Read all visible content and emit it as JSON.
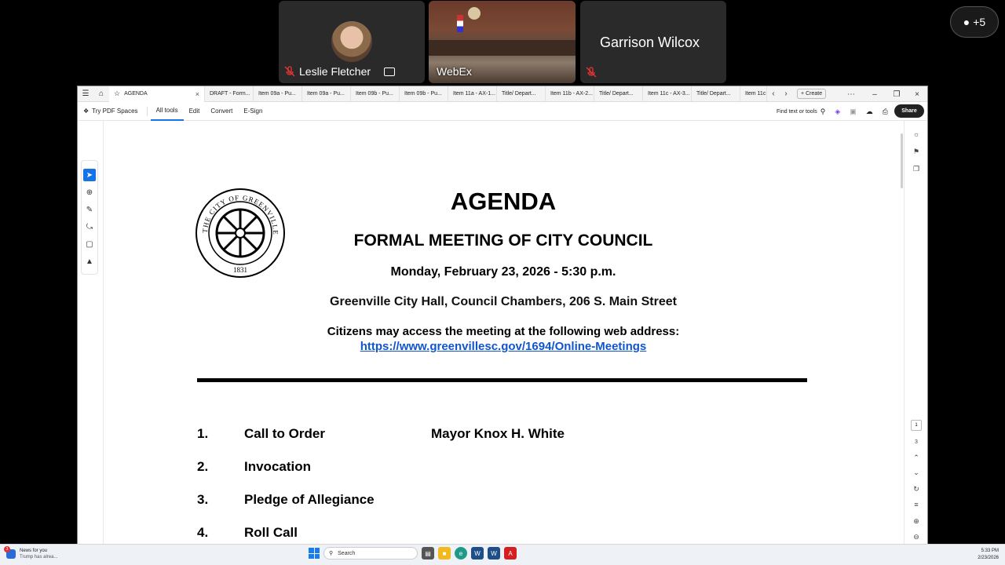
{
  "meeting": {
    "participants": [
      {
        "name": "Leslie Fletcher"
      },
      {
        "name": "WebEx"
      },
      {
        "name": "Garrison Wilcox"
      }
    ],
    "more_count": "+5"
  },
  "acrobat": {
    "tabs": [
      {
        "label": "AGENDA",
        "active": true
      },
      {
        "label": "DRAFT - Form..."
      },
      {
        "label": "Item 09a - Pu..."
      },
      {
        "label": "Item 09a - Pu..."
      },
      {
        "label": "Item 09b - Pu..."
      },
      {
        "label": "Item 09b - Pu..."
      },
      {
        "label": "Item 11a - AX-1..."
      },
      {
        "label": "Title/ Depart..."
      },
      {
        "label": "Item 11b - AX-2..."
      },
      {
        "label": "Title/ Depart..."
      },
      {
        "label": "Item 11c - AX-3..."
      },
      {
        "label": "Title/ Depart..."
      },
      {
        "label": "Item 11c"
      }
    ],
    "create_label": "Create",
    "toolbar": {
      "try_pdf_spaces": "Try PDF Spaces",
      "all_tools": "All tools",
      "edit": "Edit",
      "convert": "Convert",
      "esign": "E-Sign",
      "find": "Find text or tools",
      "share": "Share"
    },
    "page_indicator": {
      "current": "1",
      "total": "3"
    }
  },
  "document": {
    "seal_text": "THE CITY OF GREENVILLE, SOUTH CAROLINA",
    "seal_year": "1831",
    "title": "AGENDA",
    "subtitle": "FORMAL MEETING OF CITY COUNCIL",
    "date": "Monday, February 23, 2026 - 5:30 p.m.",
    "location": "Greenville City Hall, Council Chambers, 206 S. Main Street",
    "access_text": "Citizens may access the meeting at the following web address:",
    "url": "https://www.greenvillesc.gov/1694/Online-Meetings",
    "items": [
      {
        "num": "1.",
        "label": "Call to Order",
        "who": "Mayor Knox H. White"
      },
      {
        "num": "2.",
        "label": "Invocation",
        "who": ""
      },
      {
        "num": "3.",
        "label": "Pledge of Allegiance",
        "who": ""
      },
      {
        "num": "4.",
        "label": "Roll Call",
        "who": ""
      }
    ]
  },
  "taskbar": {
    "news_title": "News for you",
    "news_sub": "Trump has alrea...",
    "news_badge": "3",
    "search_placeholder": "Search",
    "time": "5:33 PM",
    "date": "2/23/2026"
  }
}
